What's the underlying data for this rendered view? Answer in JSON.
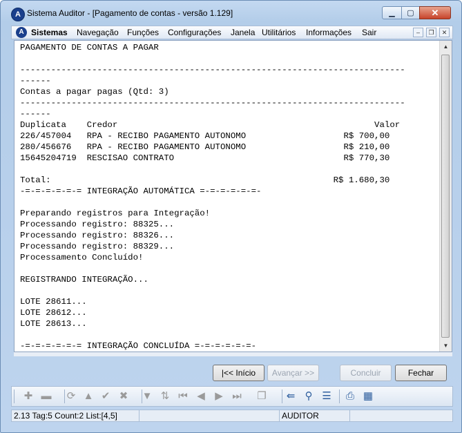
{
  "window": {
    "title": "Sistema Auditor - [Pagamento de contas - versão 1.129]",
    "controls": {
      "minimize": "▁",
      "maximize": "▢",
      "close": "✕"
    }
  },
  "menu": {
    "items": [
      "Sistemas",
      "Navegação",
      "Funções",
      "Configurações",
      "Janela",
      "Utilitários",
      "Informações",
      "Sair"
    ],
    "mdi_controls": {
      "minimize": "–",
      "restore": "❐",
      "close": "✕"
    }
  },
  "report": {
    "lines": [
      "PAGAMENTO DE CONTAS A PAGAR",
      "",
      "---------------------------------------------------------------------------",
      "------",
      "Contas a pagar pagas (Qtd: 3)",
      "---------------------------------------------------------------------------",
      "------",
      "Duplicata    Credor                                                  Valor",
      "226/457004   RPA - RECIBO PAGAMENTO AUTONOMO                   R$ 700,00",
      "280/456676   RPA - RECIBO PAGAMENTO AUTONOMO                   R$ 210,00",
      "15645204719  RESCISAO CONTRATO                                 R$ 770,30",
      "",
      "Total:                                                       R$ 1.680,30",
      "-=-=-=-=-=-= INTEGRAÇÃO AUTOMÁTICA =-=-=-=-=-=-",
      "",
      "Preparando registros para Integração!",
      "Processando registro: 88325...",
      "Processando registro: 88326...",
      "Processando registro: 88329...",
      "Processamento Concluído!",
      "",
      "REGISTRANDO INTEGRAÇÃO...",
      "",
      "LOTE 28611...",
      "LOTE 28612...",
      "LOTE 28613...",
      "",
      "-=-=-=-=-=-= INTEGRAÇÃO CONCLUÍDA =-=-=-=-=-=-"
    ]
  },
  "buttons": {
    "inicio": "|<< Início",
    "avancar": "Avançar >>",
    "concluir": "Concluir",
    "fechar": "Fechar"
  },
  "toolbar": {
    "icons": [
      {
        "name": "plus-icon",
        "glyph": "✚",
        "active": false
      },
      {
        "name": "minus-icon",
        "glyph": "▬",
        "active": false
      },
      {
        "name": "refresh-icon",
        "glyph": "⟳",
        "active": false
      },
      {
        "name": "triangle-up-icon",
        "glyph": "▲",
        "active": false
      },
      {
        "name": "check-icon",
        "glyph": "✔",
        "active": false
      },
      {
        "name": "cross-icon",
        "glyph": "✖",
        "active": false
      },
      {
        "name": "filter-icon",
        "glyph": "▼",
        "active": false
      },
      {
        "name": "sort-icon",
        "glyph": "⇅",
        "active": false
      },
      {
        "name": "first-record-icon",
        "glyph": "⏮",
        "active": false
      },
      {
        "name": "prev-record-icon",
        "glyph": "◀",
        "active": false
      },
      {
        "name": "next-record-icon",
        "glyph": "▶",
        "active": false
      },
      {
        "name": "last-record-icon",
        "glyph": "⏭",
        "active": false
      },
      {
        "name": "copy-icon",
        "glyph": "❐",
        "active": false
      },
      {
        "name": "export-icon",
        "glyph": "⇚",
        "active": true
      },
      {
        "name": "search-icon",
        "glyph": "⚲",
        "active": true
      },
      {
        "name": "list-filter-icon",
        "glyph": "☰",
        "active": true
      },
      {
        "name": "print-icon",
        "glyph": "⎙",
        "active": true
      },
      {
        "name": "calendar-icon",
        "glyph": "▦",
        "active": true
      }
    ]
  },
  "status": {
    "info": "2.13 Tag:5 Count:2 List:[4,5]",
    "cell2": "",
    "user": "AUDITOR",
    "cell4": ""
  }
}
